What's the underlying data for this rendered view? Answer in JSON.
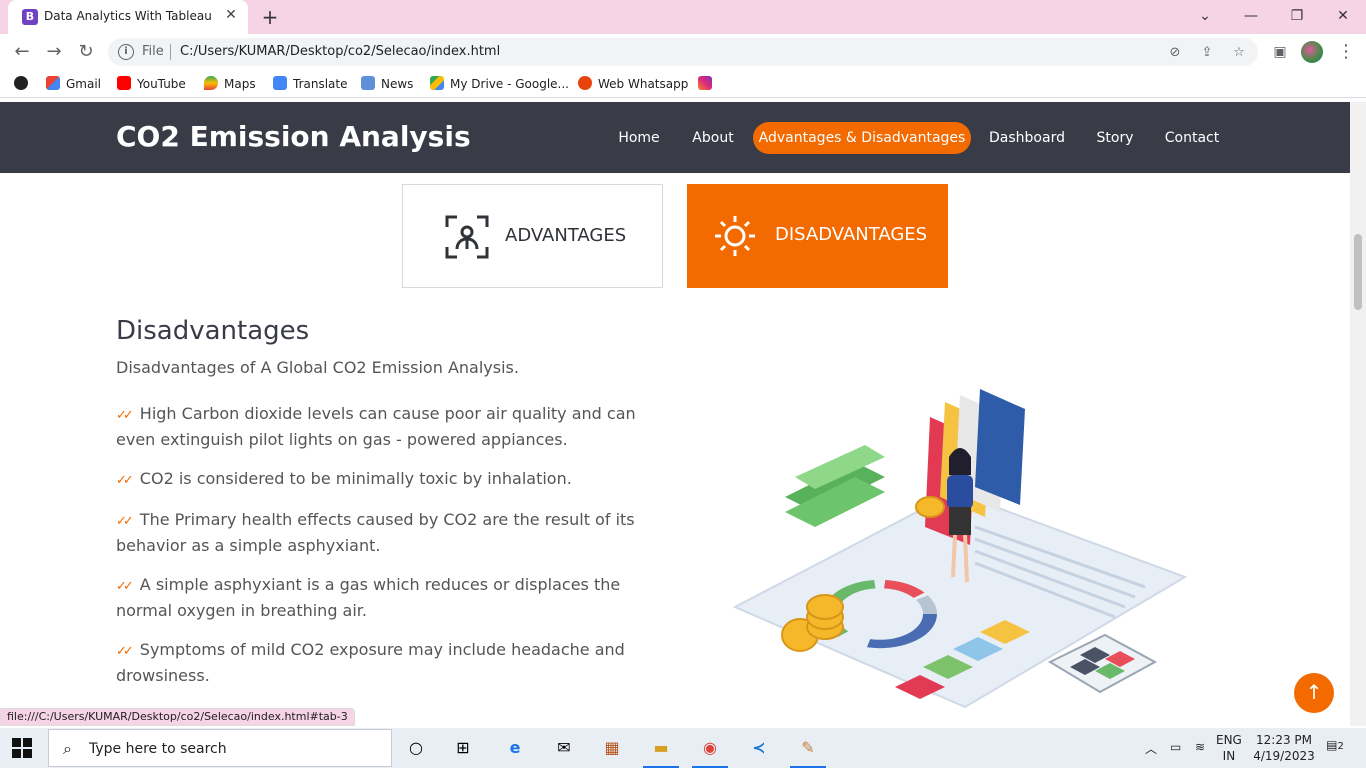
{
  "browser": {
    "tab_title": "Data Analytics With Tableau",
    "tab_favicon_letter": "B",
    "address_scheme": "File",
    "address_url": "C:/Users/KUMAR/Desktop/co2/Selecao/index.html",
    "bookmarks": [
      "Gmail",
      "YouTube",
      "Maps",
      "Translate",
      "News",
      "My Drive - Google...",
      "Web Whatsapp"
    ],
    "status_url": "file:///C:/Users/KUMAR/Desktop/co2/Selecao/index.html#tab-3"
  },
  "site": {
    "logo": "CO2 Emission Analysis",
    "nav": [
      "Home",
      "About",
      "Advantages & Disadvantages",
      "Dashboard",
      "Story",
      "Contact"
    ],
    "active_nav": "Advantages & Disadvantages"
  },
  "tabs": {
    "advantages": "ADVANTAGES",
    "disadvantages": "DISADVANTAGES"
  },
  "content": {
    "title": "Disadvantages",
    "subtitle": "Disadvantages of A Global CO2 Emission Analysis.",
    "items": [
      "High Carbon dioxide levels can cause poor air quality and can even extinguish pilot lights on gas - powered appiances.",
      "CO2 is considered to be minimally toxic by inhalation.",
      "The Primary health effects caused by CO2 are the result of its behavior as a simple asphyxiant.",
      "A simple asphyxiant is a gas which reduces or displaces the normal oxygen in breathing air.",
      "Symptoms of mild CO2 exposure may include headache and drowsiness."
    ]
  },
  "taskbar": {
    "search_placeholder": "Type here to search",
    "lang_top": "ENG",
    "lang_bottom": "IN",
    "time": "12:23 PM",
    "date": "4/19/2023",
    "notifications": "2"
  },
  "colors": {
    "accent": "#f26a00",
    "header_bg": "#393c47"
  }
}
